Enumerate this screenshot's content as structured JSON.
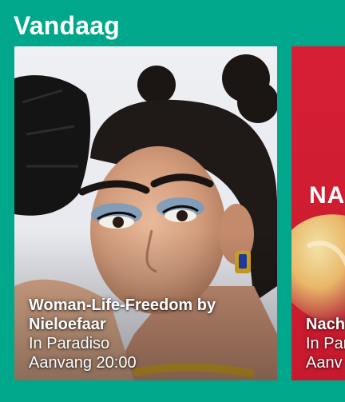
{
  "section": {
    "title": "Vandaag"
  },
  "events": [
    {
      "title": "Woman-Life-Freedom by Nieloefaar",
      "venue": "In Paradiso",
      "time": "Aanvang 20:00"
    },
    {
      "title": "Nach",
      "venue": "In Para",
      "time": "Aanv",
      "poster_text": "NA"
    }
  ],
  "colors": {
    "background": "#00a78b",
    "card2_accent": "#d9263a"
  }
}
